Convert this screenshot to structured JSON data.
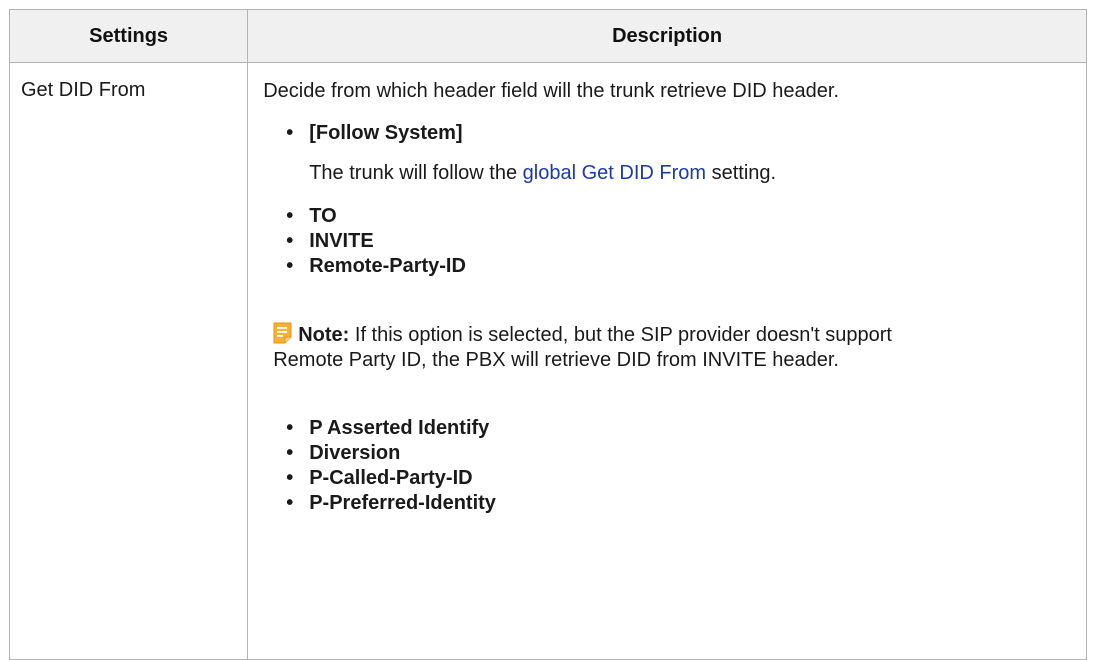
{
  "table": {
    "headers": {
      "settings": "Settings",
      "description": "Description"
    },
    "row": {
      "setting_name": "Get DID From",
      "intro": "Decide from which header field will the trunk retrieve DID header.",
      "follow_system": {
        "label": "[Follow System]",
        "text_before": "The trunk will follow the ",
        "link_text": "global Get DID From",
        "text_after": " setting."
      },
      "options_group_1": [
        "TO",
        "INVITE",
        "Remote-Party-ID"
      ],
      "note": {
        "icon": "note-icon",
        "label": "Note:",
        "text": " If this option is selected, but the SIP provider doesn't support Remote Party ID, the PBX will retrieve DID from INVITE header."
      },
      "options_group_2": [
        "P Asserted Identify",
        "Diversion",
        "P-Called-Party-ID",
        "P-Preferred-Identity"
      ]
    }
  },
  "colors": {
    "header_bg": "#f0f0f0",
    "border": "#b3b3b3",
    "link": "#1c3aa8",
    "note_icon": "#f5a623"
  }
}
